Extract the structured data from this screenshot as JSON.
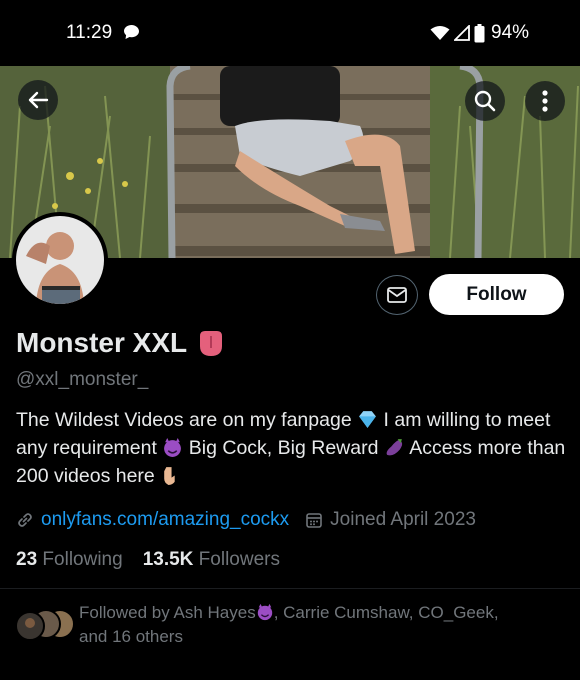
{
  "status_bar": {
    "time": "11:29",
    "battery": "94%",
    "icons": [
      "chat-bubble-icon",
      "wifi-icon",
      "signal-icon",
      "battery-icon"
    ]
  },
  "header": {
    "icons": [
      "back-arrow-icon",
      "search-icon",
      "more-vertical-icon"
    ]
  },
  "profile": {
    "name": "Monster XXL",
    "name_emoji": "tongue-emoji",
    "handle": "@xxl_monster_",
    "bio_parts": [
      "The Wildest Videos are on my fanpage",
      "I am willing to meet any requirement",
      "Big Cock, Big Reward",
      "Access more than 200 videos here"
    ],
    "bio_emojis": [
      "gem-emoji",
      "devil-emoji",
      "eggplant-emoji",
      "pointing-down-emoji"
    ],
    "link": "onlyfans.com/amazing_cockx",
    "joined": "Joined April 2023",
    "following_count": "23",
    "following_label": "Following",
    "followers_count": "13.5K",
    "followers_label": "Followers"
  },
  "actions": {
    "follow_label": "Follow"
  },
  "followed_by": {
    "prefix": "Followed by Ash Hayes",
    "rest": ", Carrie Cumshaw, CO_Geek,",
    "line2": "and 16 others"
  },
  "colors": {
    "background": "#000000",
    "text": "#e7e9ea",
    "muted": "#71767b",
    "link": "#1d9bf0",
    "follow_bg": "#ffffff"
  }
}
